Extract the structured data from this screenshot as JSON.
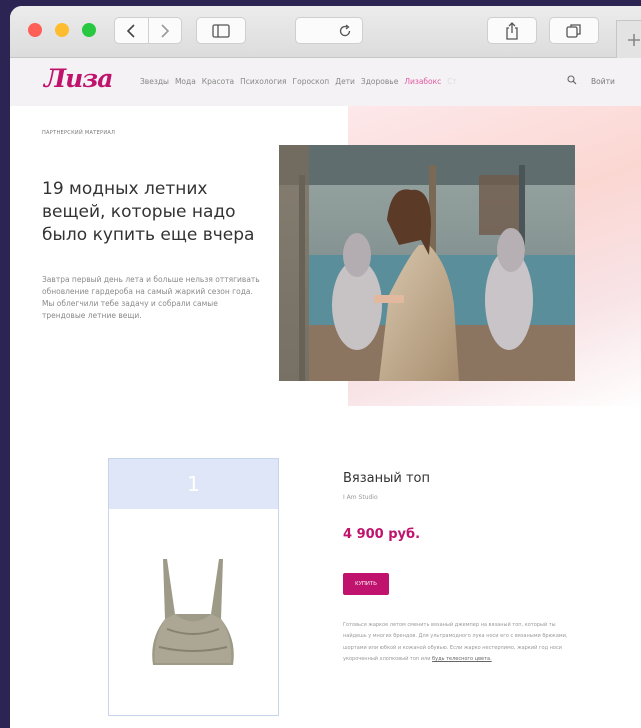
{
  "site": {
    "logo": "Лиза",
    "nav": [
      "Звезды",
      "Мода",
      "Красота",
      "Психология",
      "Гороскоп",
      "Дети",
      "Здоровье",
      "Лизабокс",
      "Ст"
    ],
    "nav_active_index": 7,
    "login": "Войти"
  },
  "hero": {
    "partner_label": "Партнерский материал",
    "title": "19 модных летних вещей, которые надо было купить еще вчера",
    "lead": "Завтра первый день лета и больше нельзя оттягивать обновление гардероба на самый жаркий сезон года. Мы облегчили тебе задачу и собрали самые трендовые летние вещи."
  },
  "product": {
    "number": "1",
    "name": "Вязаный топ",
    "brand": "I Am Studio",
    "price": "4 900 руб.",
    "buy_label": "Купить",
    "description": "Готовься жаркое летом сменить вязаный джемпер на вязаный топ, который ты найдешь у многих брендов. Для ультрамодного лука носи его с вязаными брюками, шортами или юбкой и кожаной обувью. Если жарко нестерпимо, жаркий год носи укороченный хлопковый топ или",
    "description_link": "будь телесного цвета."
  },
  "colors": {
    "brand": "#c0136e",
    "nav_active": "#e05aa3",
    "card_head": "#dfe6f7"
  }
}
